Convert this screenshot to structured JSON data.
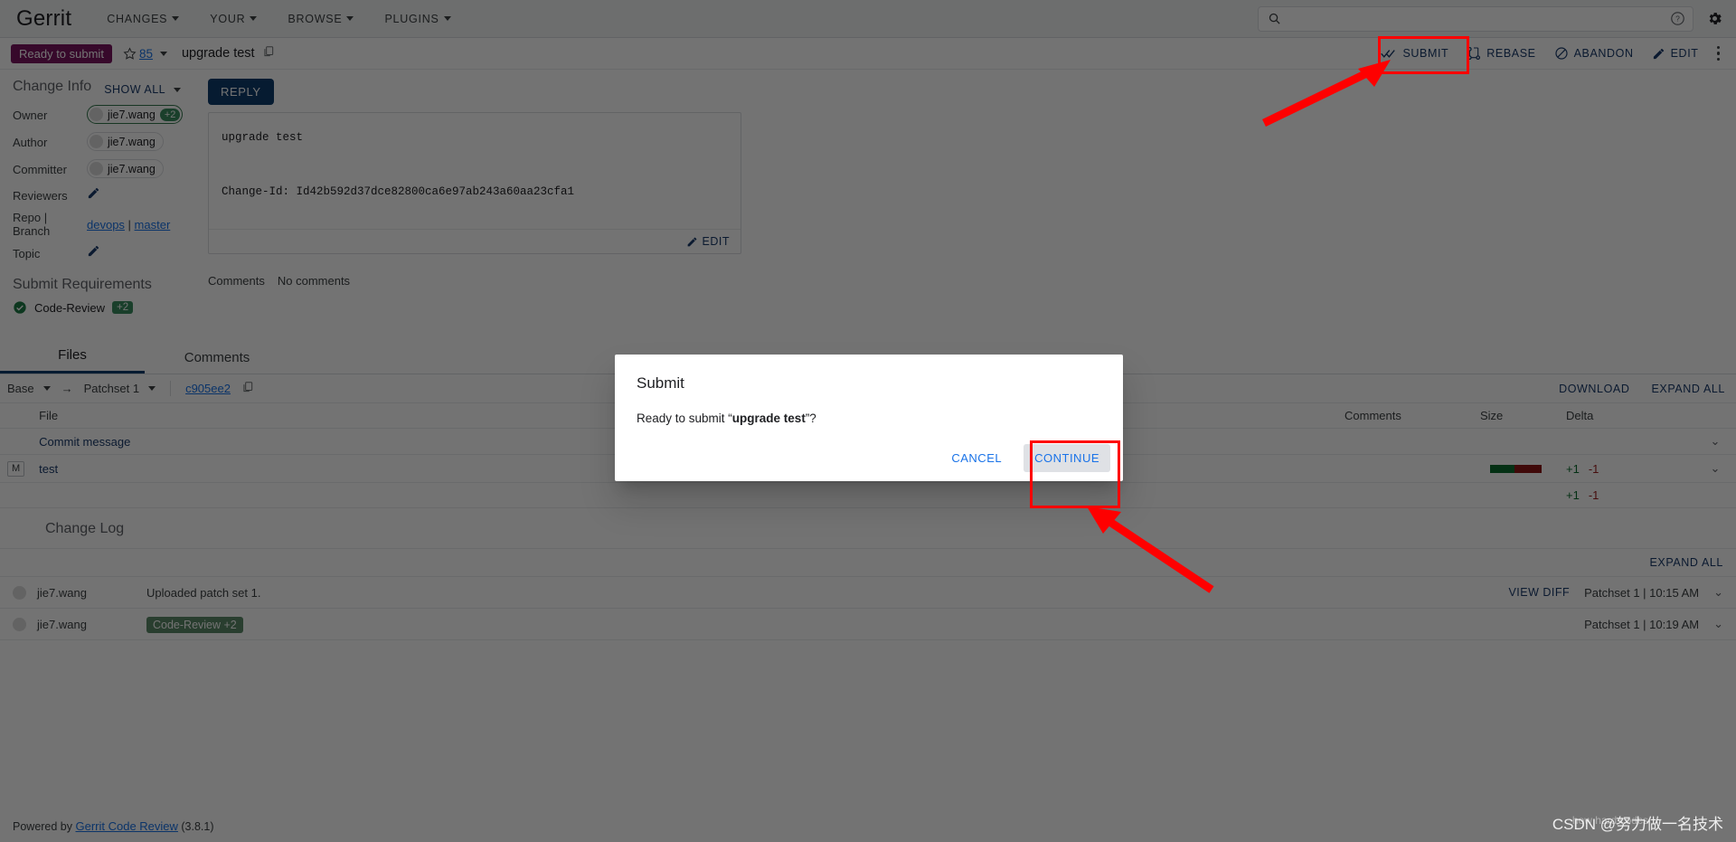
{
  "header": {
    "brand": "Gerrit",
    "nav": [
      {
        "label": "CHANGES"
      },
      {
        "label": "YOUR"
      },
      {
        "label": "BROWSE"
      },
      {
        "label": "PLUGINS"
      }
    ],
    "search": {
      "value": "",
      "placeholder": ""
    },
    "help_icon": "help-circle-icon",
    "settings_icon": "gear-icon"
  },
  "change_bar": {
    "status": "Ready to submit",
    "star_count": "85",
    "subject": "upgrade test",
    "copy_icon": "copy-icon",
    "actions": [
      {
        "label": "SUBMIT",
        "icon": "double-check-icon"
      },
      {
        "label": "REBASE",
        "icon": "rebase-icon"
      },
      {
        "label": "ABANDON",
        "icon": "block-icon"
      },
      {
        "label": "EDIT",
        "icon": "pencil-icon"
      }
    ],
    "overflow_icon": "more-vertical-icon"
  },
  "change_info": {
    "title": "Change Info",
    "show_all": "SHOW ALL",
    "rows": [
      {
        "label": "Owner",
        "value": "jie7.wang",
        "vote": "+2",
        "type": "chip-owner"
      },
      {
        "label": "Author",
        "value": "jie7.wang",
        "type": "chip"
      },
      {
        "label": "Committer",
        "value": "jie7.wang",
        "type": "chip"
      },
      {
        "label": "Reviewers",
        "value": "",
        "type": "edit"
      },
      {
        "label": "Repo | Branch",
        "repo": "devops",
        "branch": "master",
        "type": "repo"
      },
      {
        "label": "Topic",
        "value": "",
        "type": "edit"
      }
    ]
  },
  "submit_requirements": {
    "title": "Submit Requirements",
    "items": [
      {
        "label": "Code-Review",
        "score": "+2",
        "status": "satisfied"
      }
    ]
  },
  "reply": {
    "button_label": "REPLY"
  },
  "commit": {
    "message": "upgrade test\n\nChange-Id: Id42b592d37dce82800ca6e97ab243a60aa23cfa1",
    "edit_label": "EDIT"
  },
  "comments_summary": {
    "label": "Comments",
    "value": "No comments"
  },
  "tabs": [
    {
      "label": "Files",
      "active": true
    },
    {
      "label": "Comments",
      "active": false
    }
  ],
  "files_controls": {
    "base": "Base",
    "arrow": "→",
    "patchset": "Patchset 1",
    "revision": "c905ee2",
    "copy_icon": "copy-icon",
    "download": "DOWNLOAD",
    "expand_all": "EXPAND ALL"
  },
  "files_table": {
    "columns": [
      "",
      "File",
      "Comments",
      "Size",
      "Delta",
      ""
    ],
    "rows": [
      {
        "status": "",
        "file": "Commit message",
        "comments": "",
        "size_added": 0,
        "size_deleted": 0,
        "delta_add": "",
        "delta_del": "",
        "expand_icon": "chevron-down-icon"
      },
      {
        "status": "M",
        "file": "test",
        "comments": "",
        "size_added": 1,
        "size_deleted": 1,
        "delta_add": "+1",
        "delta_del": "-1",
        "expand_icon": "chevron-down-icon"
      }
    ],
    "totals": {
      "delta_add": "+1",
      "delta_del": "-1"
    }
  },
  "change_log": {
    "title": "Change Log",
    "expand_all": "EXPAND ALL",
    "entries": [
      {
        "user": "jie7.wang",
        "message": "Uploaded patch set 1.",
        "tag": "",
        "view_diff": "VIEW DIFF",
        "meta": "Patchset 1 | 10:15 AM",
        "expand_icon": "chevron-down-icon"
      },
      {
        "user": "jie7.wang",
        "message": "",
        "tag": "Code-Review +2",
        "view_diff": "",
        "meta": "Patchset 1 | 10:19 AM",
        "expand_icon": "chevron-down-icon"
      }
    ]
  },
  "modal": {
    "title": "Submit",
    "body_prefix": "Ready to submit “",
    "body_strong": "upgrade test",
    "body_suffix": "”?",
    "cancel_label": "CANCEL",
    "continue_label": "CONTINUE"
  },
  "footer": {
    "powered_prefix": "Powered by ",
    "link": "Gerrit Code Review",
    "version": " (3.8.1)"
  },
  "watermark": {
    "text": "CSDN @努力做一名技术",
    "ghost": "how hard codcs"
  },
  "colors": {
    "brand_blue": "#0f3c6e",
    "link_blue": "#1a73e8",
    "status_magenta": "#7b1560",
    "vote_green": "#3a8c5f",
    "annotation_red": "#fe0000",
    "add_green": "#0b6b2e",
    "del_red": "#8c1515"
  }
}
